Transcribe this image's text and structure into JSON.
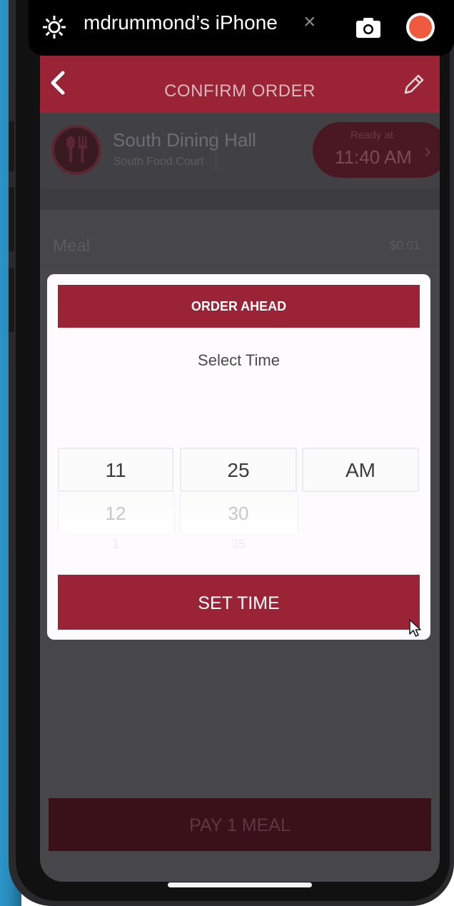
{
  "mirror_toolbar": {
    "device_name": "mdrummond’s iPhone",
    "close_symbol": "×",
    "icons": [
      "gear-icon",
      "camera-icon",
      "record-icon"
    ],
    "record_color": "#f05a3f"
  },
  "app": {
    "header": {
      "title": "CONFIRM ORDER",
      "back_icon": "chevron-left-icon",
      "edit_icon": "pencil-icon",
      "color": "#9b2336"
    },
    "location": {
      "name": "South Dining Hall",
      "subtitle": "South Food Court",
      "icon": "utensils-icon",
      "ready_label": "Ready at",
      "ready_time": "11:40 AM"
    },
    "line_item": {
      "label": "Meal",
      "price": "$0.01"
    },
    "pay_button": "PAY 1 MEAL"
  },
  "modal": {
    "title": "ORDER AHEAD",
    "subtitle": "Select Time",
    "picker": {
      "hour": "11",
      "minute": "25",
      "period": "AM",
      "next_hour": "12",
      "next_minute": "30",
      "next2_hour": "1",
      "next2_minute": "35"
    },
    "set_button": "SET TIME"
  }
}
